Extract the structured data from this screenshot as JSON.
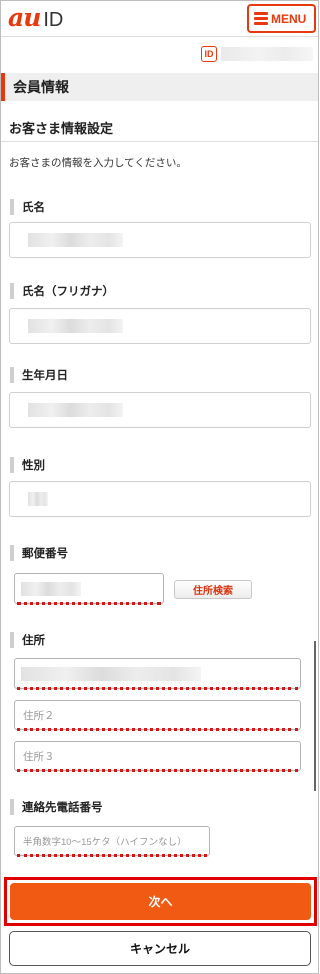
{
  "header": {
    "logo_au": "au",
    "logo_id": "ID",
    "menu_label": "MENU"
  },
  "account": {
    "id_badge": "ID"
  },
  "section": {
    "title": "会員情報"
  },
  "subsection": {
    "title": "お客さま情報設定"
  },
  "intro_text": "お客さまの情報を入力してください。",
  "fields": {
    "name": {
      "label": "氏名"
    },
    "name_kana": {
      "label": "氏名（フリガナ）"
    },
    "birthdate": {
      "label": "生年月日"
    },
    "gender": {
      "label": "性別"
    },
    "postal": {
      "label": "郵便番号",
      "search_button": "住所検索"
    },
    "address": {
      "label": "住所",
      "placeholder2": "住所２",
      "placeholder3": "住所３"
    },
    "phone": {
      "label": "連絡先電話番号",
      "placeholder": "半角数字10〜15ケタ（ハイフンなし）"
    }
  },
  "buttons": {
    "next": "次へ",
    "cancel": "キャンセル"
  },
  "colors": {
    "accent": "#e8380d",
    "next_button": "#f05a12",
    "error_underline": "#d81414"
  }
}
